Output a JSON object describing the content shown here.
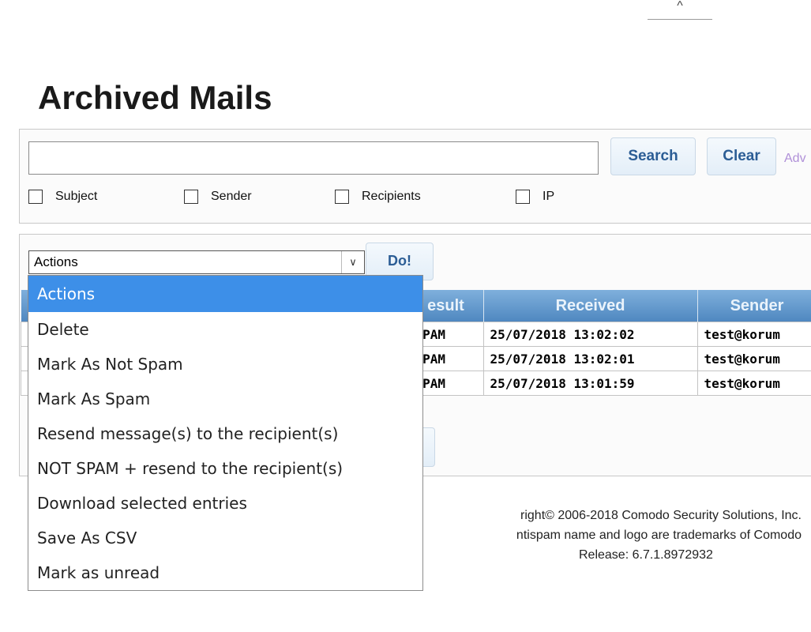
{
  "page": {
    "top_tab_glyph": "^",
    "title": "Archived Mails"
  },
  "search": {
    "input_value": "",
    "search_label": "Search",
    "clear_label": "Clear",
    "advanced_label": "Adv",
    "filters": [
      "Subject",
      "Sender",
      "Recipients",
      "IP"
    ]
  },
  "actions": {
    "selected": "Actions",
    "do_label": "Do!",
    "options": [
      "Actions",
      "Delete",
      "Mark As Not Spam",
      "Mark As Spam",
      "Resend message(s) to the recipient(s)",
      "NOT SPAM + resend to the recipient(s)",
      "Download selected entries",
      "Save As CSV",
      "Mark as unread"
    ]
  },
  "table": {
    "columns": [
      "esult",
      "Received",
      "Sender"
    ],
    "rows": [
      {
        "result": "SPAM",
        "received": "25/07/2018 13:02:02",
        "sender": "test@korum"
      },
      {
        "result": "SPAM",
        "received": "25/07/2018 13:02:01",
        "sender": "test@korum"
      },
      {
        "result": "SPAM",
        "received": "25/07/2018 13:01:59",
        "sender": "test@korum"
      }
    ]
  },
  "footer": {
    "line1": "right© 2006-2018 Comodo Security Solutions, Inc.",
    "line2": "ntispam name and logo are trademarks of Comodo",
    "line3": "Release: 6.7.1.8972932"
  },
  "colors": {
    "accent": "#3d8fe8",
    "header_blue": "#5b93c8",
    "button_text": "#2b5d95"
  }
}
